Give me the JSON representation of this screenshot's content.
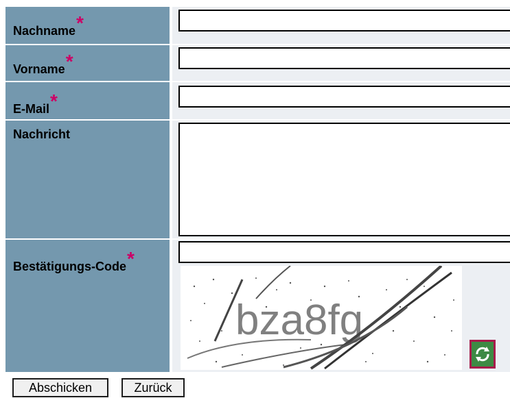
{
  "form": {
    "required_marker": "*",
    "fields": {
      "lastname": {
        "label": "Nachname",
        "value": ""
      },
      "firstname": {
        "label": "Vorname",
        "value": ""
      },
      "email": {
        "label": "E-Mail",
        "value": ""
      },
      "message": {
        "label": "Nachricht",
        "value": ""
      },
      "captcha": {
        "label": "Bestätigungs-Code",
        "value": "",
        "image_text": "bza8fg"
      }
    },
    "buttons": {
      "submit": "Abschicken",
      "back": "Zurück"
    }
  },
  "colors": {
    "label_bg": "#7498AE",
    "field_bg": "#ECEFF3",
    "required_marker": "#CC0066",
    "refresh_border": "#A7194B",
    "refresh_fill": "#2F7A36"
  },
  "icons": {
    "captcha_refresh": "refresh-icon"
  }
}
